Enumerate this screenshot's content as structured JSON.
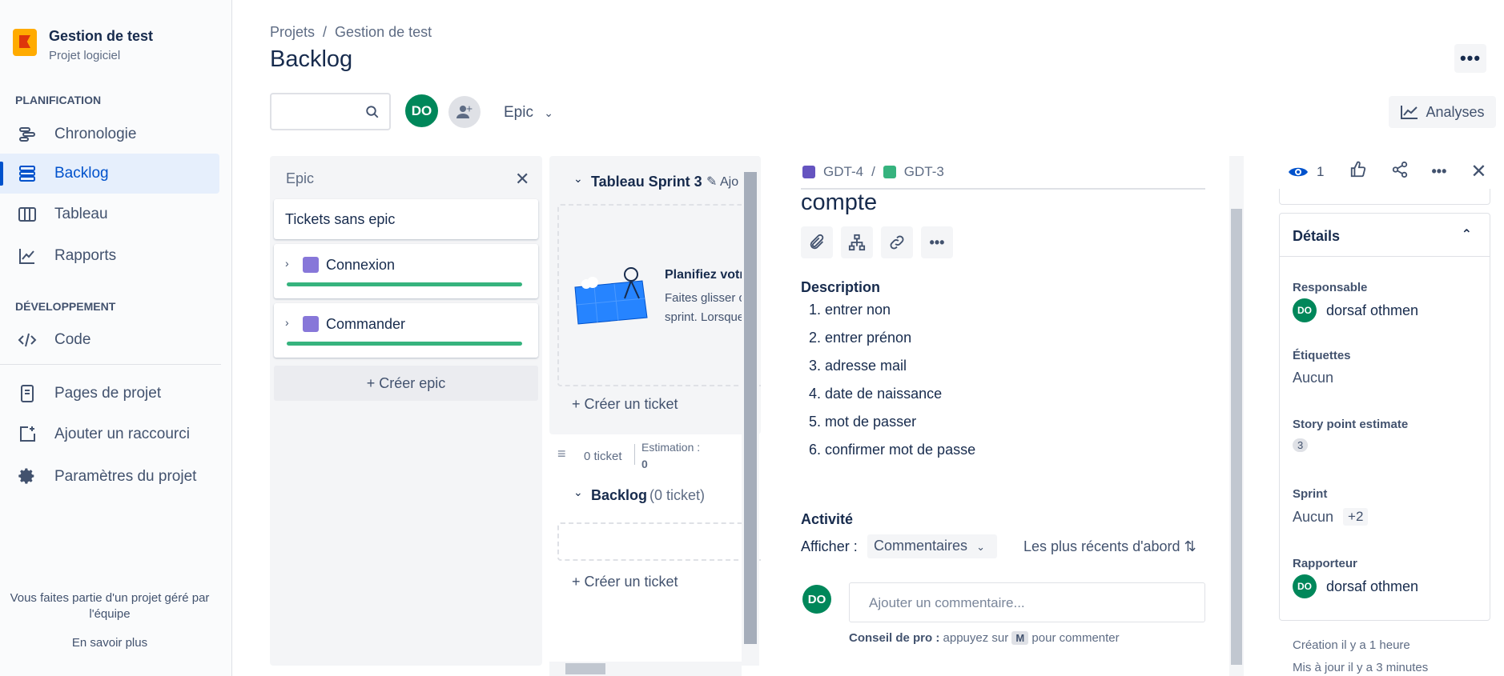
{
  "project": {
    "name": "Gestion de test",
    "type": "Projet logiciel"
  },
  "sidebar": {
    "planning_title": "PLANIFICATION",
    "dev_title": "DÉVELOPPEMENT",
    "items": [
      {
        "label": "Chronologie",
        "icon": "timeline-icon"
      },
      {
        "label": "Backlog",
        "icon": "backlog-icon"
      },
      {
        "label": "Tableau",
        "icon": "board-icon"
      },
      {
        "label": "Rapports",
        "icon": "reports-icon"
      },
      {
        "label": "Code",
        "icon": "code-icon"
      },
      {
        "label": "Pages de projet",
        "icon": "page-icon"
      },
      {
        "label": "Ajouter un raccourci",
        "icon": "add-shortcut-icon"
      },
      {
        "label": "Paramètres du projet",
        "icon": "gear-icon"
      }
    ],
    "footer_text": "Vous faites partie d'un projet géré par l'équipe",
    "footer_link": "En savoir plus"
  },
  "header": {
    "breadcrumb": [
      "Projets",
      "Gestion de test"
    ],
    "title": "Backlog",
    "avatar": "DO",
    "epic_filter": "Epic",
    "analyses": "Analyses"
  },
  "epic_panel": {
    "title": "Epic",
    "no_epic": "Tickets sans epic",
    "epics": [
      "Connexion",
      "Commander"
    ],
    "create": "+ Créer epic"
  },
  "sprint": {
    "title": "Tableau Sprint 3",
    "add_label": "Ajo",
    "empty_title": "Planifiez votre",
    "empty_text_1": "Faites glisser c",
    "empty_text_2": "sprint. Lorsque",
    "create_ticket": "Créer un ticket",
    "ticket_count": "0 ticket",
    "estimation_label": "Estimation :",
    "estimation_value": "0",
    "backlog_title": "Backlog",
    "backlog_count": "(0 ticket)",
    "backlog_create": "Créer un ticket"
  },
  "issue": {
    "parent_key": "GDT-4",
    "key": "GDT-3",
    "title_fragment": "compte",
    "description_title": "Description",
    "description_items": [
      "1. entrer non",
      "2. entrer prénon",
      "3. adresse mail",
      "4. date de naissance",
      "5. mot de passer",
      "6. confirmer mot de passe"
    ],
    "activity_title": "Activité",
    "show_label": "Afficher :",
    "show_value": "Commentaires",
    "sort_label": "Les plus récents d'abord",
    "comment_avatar": "DO",
    "comment_placeholder": "Ajouter un commentaire...",
    "tip_bold": "Conseil de pro :",
    "tip_pre": "appuyez sur",
    "tip_key": "M",
    "tip_post": "pour commenter"
  },
  "details": {
    "watch_count": "1",
    "title": "Détails",
    "assignee_label": "Responsable",
    "assignee": "dorsaf othmen",
    "assignee_avatar": "DO",
    "labels_label": "Étiquettes",
    "labels_value": "Aucun",
    "story_points_label": "Story point estimate",
    "story_points": "3",
    "sprint_label": "Sprint",
    "sprint_value": "Aucun",
    "sprint_extra": "+2",
    "reporter_label": "Rapporteur",
    "reporter": "dorsaf othmen",
    "reporter_avatar": "DO",
    "created": "Création il y a 1 heure",
    "updated": "Mis à jour il y a 3 minutes"
  },
  "colors": {
    "accent": "#0052cc",
    "avatar": "#00875a",
    "epic": "#8777d9",
    "progress": "#36b37e"
  }
}
